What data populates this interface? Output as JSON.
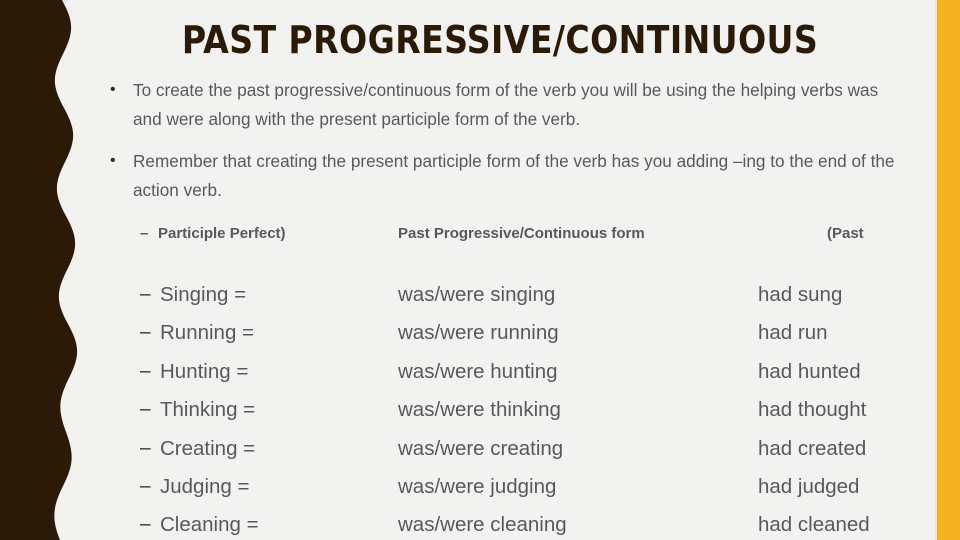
{
  "slide": {
    "title": "PAST PROGRESSIVE/CONTINUOUS",
    "colors": {
      "background": "#f2f2f0",
      "left_border": "#2b1a05",
      "right_border": "#f5b121",
      "title_text": "#2b1a05",
      "body_text": "#595959"
    }
  },
  "bullets": [
    {
      "marker": "•",
      "text": "To create the past progressive/continuous form of the verb you will be using the helping verbs was and were along with the present participle form of the verb."
    },
    {
      "marker": "•",
      "text": "Remember that creating the present participle form of the verb has you adding –ing to the end of the action verb."
    }
  ],
  "table": {
    "header": {
      "marker": "–",
      "col_a": "Participle Perfect)",
      "col_b": "Past Progressive/Continuous form",
      "col_c": "(Past"
    },
    "row_marker": "–",
    "rows": [
      {
        "participle": "Singing =",
        "progressive": "was/were singing",
        "perfect": "had sung"
      },
      {
        "participle": "Running =",
        "progressive": "was/were running",
        "perfect": "had run"
      },
      {
        "participle": "Hunting =",
        "progressive": "was/were hunting",
        "perfect": "had hunted"
      },
      {
        "participle": "Thinking =",
        "progressive": "was/were thinking",
        "perfect": "had thought"
      },
      {
        "participle": "Creating =",
        "progressive": "was/were creating",
        "perfect": "had created"
      },
      {
        "participle": "Judging =",
        "progressive": "was/were judging",
        "perfect": "had judged"
      },
      {
        "participle": "Cleaning =",
        "progressive": "was/were cleaning",
        "perfect": "had cleaned"
      }
    ]
  }
}
